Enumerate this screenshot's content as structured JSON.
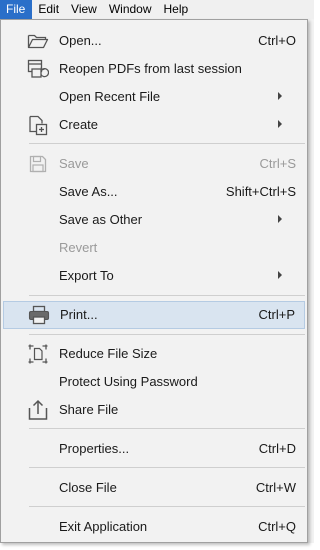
{
  "menubar": {
    "items": [
      {
        "label": "File",
        "active": true
      },
      {
        "label": "Edit",
        "active": false
      },
      {
        "label": "View",
        "active": false
      },
      {
        "label": "Window",
        "active": false
      },
      {
        "label": "Help",
        "active": false
      }
    ]
  },
  "file_menu": {
    "open": {
      "label": "Open...",
      "shortcut": "Ctrl+O",
      "icon": "folder-open-icon"
    },
    "reopen": {
      "label": "Reopen PDFs from last session",
      "icon": "reopen-documents-icon"
    },
    "open_recent": {
      "label": "Open Recent File"
    },
    "create": {
      "label": "Create",
      "icon": "create-document-icon"
    },
    "save": {
      "label": "Save",
      "shortcut": "Ctrl+S",
      "icon": "save-disk-icon",
      "enabled": false
    },
    "save_as": {
      "label": "Save As...",
      "shortcut": "Shift+Ctrl+S"
    },
    "save_as_other": {
      "label": "Save as Other"
    },
    "revert": {
      "label": "Revert",
      "enabled": false
    },
    "export_to": {
      "label": "Export To"
    },
    "print": {
      "label": "Print...",
      "shortcut": "Ctrl+P",
      "icon": "printer-icon",
      "highlighted": true
    },
    "reduce_size": {
      "label": "Reduce File Size",
      "icon": "reduce-file-size-icon"
    },
    "protect": {
      "label": "Protect Using Password"
    },
    "share": {
      "label": "Share File",
      "icon": "share-upload-icon"
    },
    "properties": {
      "label": "Properties...",
      "shortcut": "Ctrl+D"
    },
    "close": {
      "label": "Close File",
      "shortcut": "Ctrl+W"
    },
    "exit": {
      "label": "Exit Application",
      "shortcut": "Ctrl+Q"
    }
  },
  "colors": {
    "menubar_active": "#2a6fc9",
    "menu_bg": "#f2f2f2",
    "highlight_bg": "#d9e4f0",
    "disabled_text": "#9a9a9a"
  }
}
